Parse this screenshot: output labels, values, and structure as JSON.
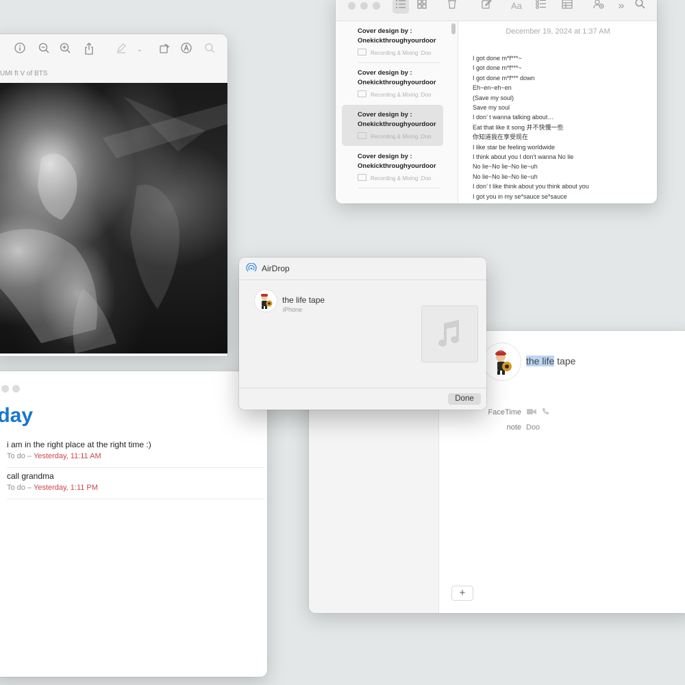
{
  "preview": {
    "subtitle": "UMI ft V of BTS",
    "toolbar_icons": [
      "info-icon",
      "zoom-out-icon",
      "zoom-in-icon",
      "share-icon",
      "markup-icon",
      "rotate-icon",
      "annotate-icon",
      "search-icon"
    ]
  },
  "reminders": {
    "title": "oday",
    "items": [
      {
        "title": "i am in the right place at the right time :)",
        "list": "To do – ",
        "when": "Yesterday, 11:11 AM"
      },
      {
        "title": "call grandma",
        "list": "To do – ",
        "when": "Yesterday, 1:11 PM"
      }
    ]
  },
  "notes": {
    "toolbar_icons": [
      "list-view-icon",
      "gallery-view-icon",
      "trash-icon",
      "compose-icon",
      "format-icon",
      "checklist-icon",
      "table-icon",
      "collaborate-icon",
      "more-icon",
      "search-icon"
    ],
    "format_label": "Aa",
    "list": [
      {
        "title_line1": "Cover design by :",
        "title_line2": "Onekickthroughyourdoor",
        "folder": "Recording & Mixing :Doo"
      },
      {
        "title_line1": "Cover design by :",
        "title_line2": "Onekickthroughyourdoor",
        "folder": "Recording & Mixing :Doo"
      },
      {
        "title_line1": "Cover design by :",
        "title_line2": "Onekickthroughyourdoor",
        "folder": "Recording & Mixing :Doo"
      },
      {
        "title_line1": "Cover design by :",
        "title_line2": "Onekickthroughyourdoor",
        "folder": "Recording & Mixing :Doo"
      }
    ],
    "date": "December 19, 2024 at 1:37 AM",
    "lyrics": [
      "I got done m*f***~",
      "I got done m*f***~",
      "I got done m*f*** down",
      "Eh~en~eh~en",
      "(Save my soul)",
      "Save my soul",
      "I don’ t wanna talking about…",
      "Eat that like it song 并不快慢一些",
      "你知道我在享受现在",
      "I like star be feeling worldwide",
      "I think about you I don't wanna No lie",
      "No lie~No lie~No lie~uh",
      "No lie~No lie~No lie~uh",
      "I don’ t like think about you think about you",
      "I got you in my se*sauce  se*sauce"
    ]
  },
  "airdrop": {
    "title": "AirDrop",
    "device_name": "the life tape",
    "device_type": "iPhone",
    "done_label": "Done"
  },
  "contacts": {
    "name_highlight": "the life",
    "name_rest": " tape",
    "facetime_label": "FaceTime",
    "note_label": "note",
    "note_value": "Doo",
    "add_label": "+"
  }
}
